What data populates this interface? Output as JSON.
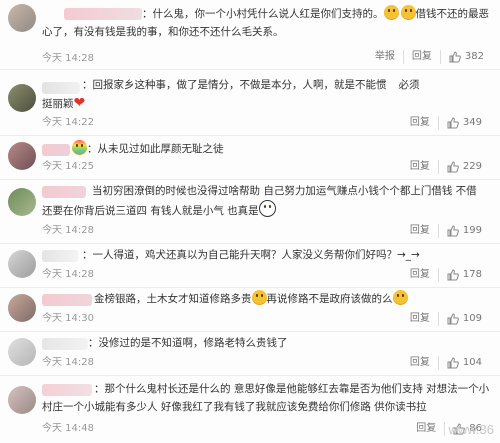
{
  "comments": [
    {
      "text_line1": "：什么鬼，你一个小村凭什么说人红是你们支持的。",
      "text_line1b": "借钱不还的最恶",
      "text_line2": "心了，有没有钱是我的事，和你还不还什么毛关系。",
      "time": "今天 14:28",
      "report": "举报",
      "reply": "回复",
      "likes": "382"
    },
    {
      "text_line1": "：回报家乡这种事，做了是情分，不做是本分，人啊，就是不能惯",
      "text_line1b": "必须",
      "text_line2": "挺丽颖",
      "time": "今天 14:22",
      "reply": "回复",
      "likes": "349"
    },
    {
      "text_line1": "：从未见过如此厚颜无耻之徒",
      "time": "今天 14:25",
      "reply": "回复",
      "likes": "229"
    },
    {
      "text_line1": "当初穷困潦倒的时候也没得过啥帮助 自己努力加运气赚点小钱个个都上门借钱 不借",
      "text_line2": "还要在你背后说三道四 有钱人就是小气 也真是",
      "time": "今天 14:28",
      "reply": "回复",
      "likes": "199"
    },
    {
      "text_line1": "：一人得道，鸡犬还真以为自己能升天啊？人家没义务帮你们好吗？→_→",
      "time": "今天 14:28",
      "reply": "回复",
      "likes": "178"
    },
    {
      "text_line1": "金榜银路，土木女才知道修路多贵",
      "text_line1b": "再说修路不是政府该做的么",
      "time": "今天 14:30",
      "reply": "回复",
      "likes": "109"
    },
    {
      "text_line1": "：没修过的是不知道啊，修路老特么贵钱了",
      "time": "今天 14:28",
      "reply": "回复",
      "likes": "104"
    },
    {
      "text_line1": "：那个什么鬼村长还是什么的 意思好像是他能够红去靠是否为他们支持 对想法一个小",
      "text_line2": "村庄一个小城能有多少人 好像我红了我有钱了我就应该免费给你们修路 供你读书拉",
      "time": "今天 14:48",
      "reply": "回复",
      "likes": "86"
    }
  ],
  "watermark": "www.36",
  "colors": {
    "text": "#333333",
    "meta": "#999999",
    "heart": "#e0322b",
    "emoji": "#f6c235"
  }
}
